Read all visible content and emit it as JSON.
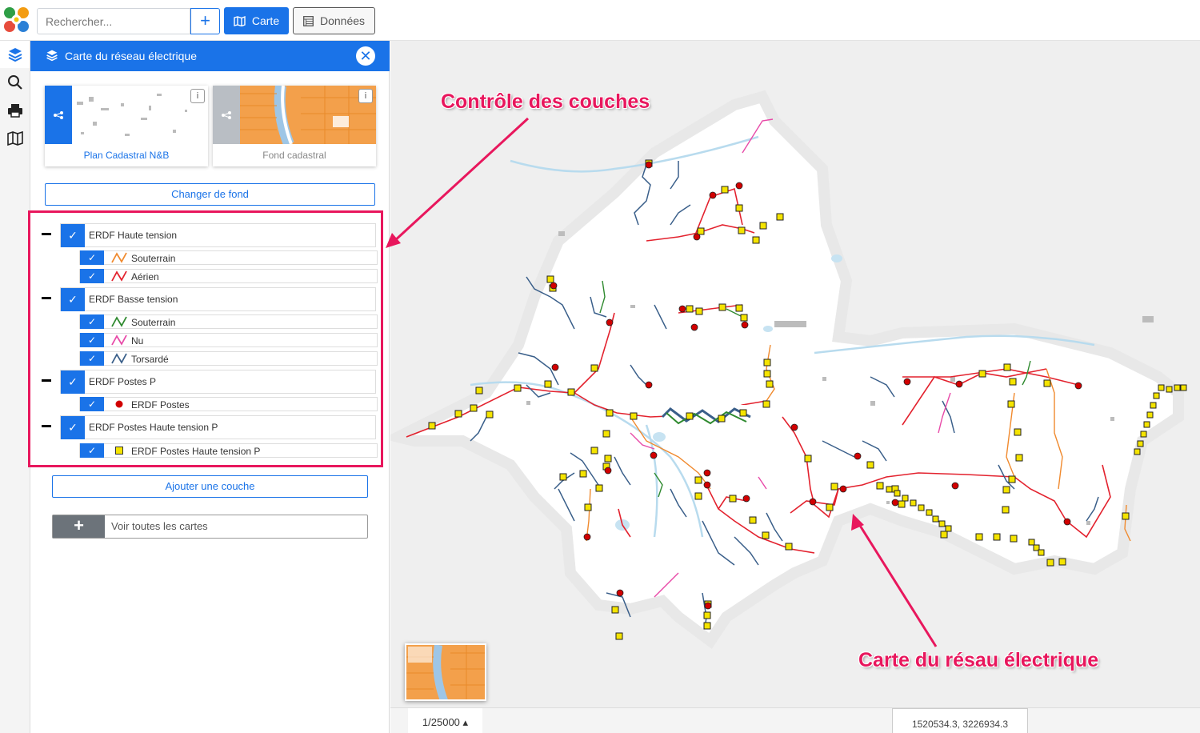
{
  "topbar": {
    "search_placeholder": "Rechercher...",
    "add_label": "+",
    "carte_label": "Carte",
    "donnees_label": "Données"
  },
  "rail": {
    "items": [
      "layers-icon",
      "search-icon",
      "print-icon",
      "map-icon"
    ]
  },
  "panel": {
    "title": "Carte du réseau électrique",
    "backgrounds": [
      {
        "label": "Plan Cadastral N&B",
        "active": true
      },
      {
        "label": "Fond cadastral",
        "active": false
      }
    ],
    "change_bg_label": "Changer de fond",
    "layer_groups": [
      {
        "label": "ERDF Haute tension",
        "checked": true,
        "children": [
          {
            "label": "Souterrain",
            "symbol": "line",
            "color": "#f08a2e"
          },
          {
            "label": "Aérien",
            "symbol": "line",
            "color": "#e3222e"
          }
        ]
      },
      {
        "label": "ERDF Basse tension",
        "checked": true,
        "children": [
          {
            "label": "Souterrain",
            "symbol": "line",
            "color": "#2f8a2f"
          },
          {
            "label": "Nu",
            "symbol": "line",
            "color": "#e84aa8"
          },
          {
            "label": "Torsardé",
            "symbol": "line",
            "color": "#3a5f8a"
          }
        ]
      },
      {
        "label": "ERDF Postes P",
        "checked": true,
        "children": [
          {
            "label": "ERDF Postes",
            "symbol": "circle",
            "color": "#d10000"
          }
        ]
      },
      {
        "label": "ERDF Postes Haute tension P",
        "checked": true,
        "children": [
          {
            "label": "ERDF Postes Haute tension P",
            "symbol": "square",
            "color": "#f5e400"
          }
        ]
      }
    ],
    "add_layer_label": "Ajouter une couche",
    "all_maps_label": "Voir toutes les cartes"
  },
  "map": {
    "scale": "1/25000 ▴",
    "coords": "1520534.3, 3226934.3"
  },
  "annotations": {
    "layers_control": "Contrôle des couches",
    "network_map": "Carte du résau électrique"
  },
  "colors": {
    "accent": "#1a73e8",
    "annotation": "#e8175d",
    "hv_aerien": "#e3222e",
    "hv_souterrain": "#f08a2e",
    "bt_torsade": "#3a5f8a",
    "poste": "#d10000",
    "poste_ht": "#f5e400"
  }
}
